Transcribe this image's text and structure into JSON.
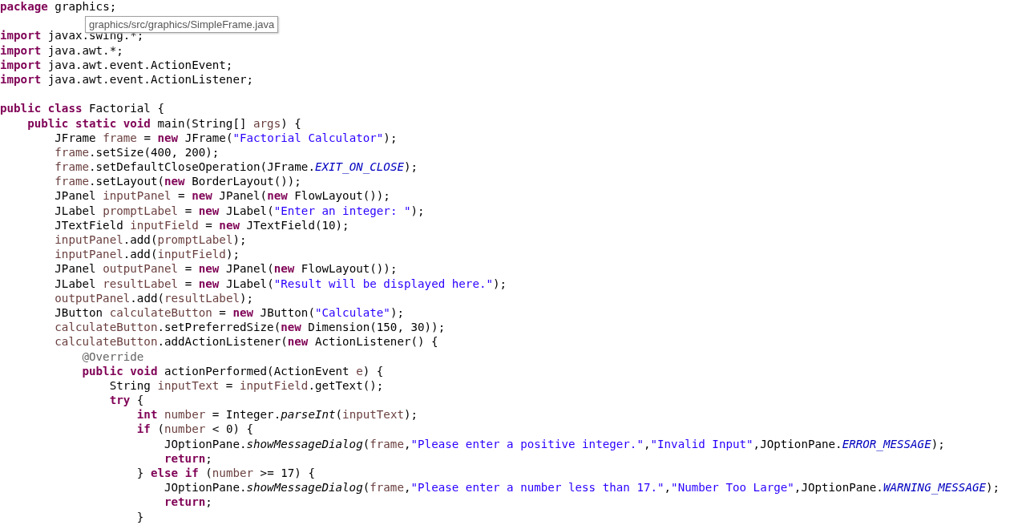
{
  "editor": {
    "lines": [
      {
        "kind": "code",
        "tokens": [
          {
            "kind": "keyword",
            "text": "package"
          },
          {
            "kind": "plain",
            "text": " graphics;"
          }
        ]
      },
      {
        "kind": "blank"
      },
      {
        "kind": "code",
        "tokens": [
          {
            "kind": "keyword",
            "text": "import"
          },
          {
            "kind": "plain",
            "text": " javax.swing.*;"
          }
        ]
      },
      {
        "kind": "code",
        "tokens": [
          {
            "kind": "keyword",
            "text": "import"
          },
          {
            "kind": "plain",
            "text": " java.awt.*;"
          }
        ]
      },
      {
        "kind": "code",
        "tokens": [
          {
            "kind": "keyword",
            "text": "import"
          },
          {
            "kind": "plain",
            "text": " java.awt.event.ActionEvent;"
          }
        ]
      },
      {
        "kind": "code",
        "tokens": [
          {
            "kind": "keyword",
            "text": "import"
          },
          {
            "kind": "plain",
            "text": " java.awt.event.ActionListener;"
          }
        ]
      },
      {
        "kind": "blank"
      },
      {
        "kind": "code",
        "tokens": [
          {
            "kind": "keyword",
            "text": "public class"
          },
          {
            "kind": "plain",
            "text": " Factorial {"
          }
        ],
        "children": [
          {
            "kind": "code",
            "tokens": [
              {
                "kind": "keyword",
                "text": "public static void"
              },
              {
                "kind": "plain",
                "text": " main(String[] "
              },
              {
                "kind": "variable",
                "text": "args"
              },
              {
                "kind": "plain",
                "text": ") {"
              }
            ],
            "children": [
              {
                "kind": "code",
                "tokens": [
                  {
                    "kind": "plain",
                    "text": "JFrame "
                  },
                  {
                    "kind": "variable",
                    "text": "frame"
                  },
                  {
                    "kind": "plain",
                    "text": " = "
                  },
                  {
                    "kind": "keyword",
                    "text": "new"
                  },
                  {
                    "kind": "plain",
                    "text": " JFrame("
                  },
                  {
                    "kind": "string",
                    "text": "\"Factorial Calculator\""
                  },
                  {
                    "kind": "plain",
                    "text": ");"
                  }
                ]
              },
              {
                "kind": "code",
                "tokens": [
                  {
                    "kind": "variable",
                    "text": "frame"
                  },
                  {
                    "kind": "plain",
                    "text": ".setSize(400, 200);"
                  }
                ]
              },
              {
                "kind": "code",
                "tokens": [
                  {
                    "kind": "variable",
                    "text": "frame"
                  },
                  {
                    "kind": "plain",
                    "text": ".setDefaultCloseOperation(JFrame."
                  },
                  {
                    "kind": "constant",
                    "text": "EXIT_ON_CLOSE"
                  },
                  {
                    "kind": "plain",
                    "text": ");"
                  }
                ]
              },
              {
                "kind": "code",
                "tokens": [
                  {
                    "kind": "variable",
                    "text": "frame"
                  },
                  {
                    "kind": "plain",
                    "text": ".setLayout("
                  },
                  {
                    "kind": "keyword",
                    "text": "new"
                  },
                  {
                    "kind": "plain",
                    "text": " BorderLayout());"
                  }
                ]
              },
              {
                "kind": "code",
                "tokens": [
                  {
                    "kind": "plain",
                    "text": "JPanel "
                  },
                  {
                    "kind": "variable",
                    "text": "inputPanel"
                  },
                  {
                    "kind": "plain",
                    "text": " = "
                  },
                  {
                    "kind": "keyword",
                    "text": "new"
                  },
                  {
                    "kind": "plain",
                    "text": " JPanel("
                  },
                  {
                    "kind": "keyword",
                    "text": "new"
                  },
                  {
                    "kind": "plain",
                    "text": " FlowLayout());"
                  }
                ]
              },
              {
                "kind": "code",
                "tokens": [
                  {
                    "kind": "plain",
                    "text": "JLabel "
                  },
                  {
                    "kind": "variable",
                    "text": "promptLabel"
                  },
                  {
                    "kind": "plain",
                    "text": " = "
                  },
                  {
                    "kind": "keyword",
                    "text": "new"
                  },
                  {
                    "kind": "plain",
                    "text": " JLabel("
                  },
                  {
                    "kind": "string",
                    "text": "\"Enter an integer: \""
                  },
                  {
                    "kind": "plain",
                    "text": ");"
                  }
                ]
              },
              {
                "kind": "code",
                "tokens": [
                  {
                    "kind": "plain",
                    "text": "JTextField "
                  },
                  {
                    "kind": "variable",
                    "text": "inputField"
                  },
                  {
                    "kind": "plain",
                    "text": " = "
                  },
                  {
                    "kind": "keyword",
                    "text": "new"
                  },
                  {
                    "kind": "plain",
                    "text": " JTextField(10);"
                  }
                ]
              },
              {
                "kind": "code",
                "tokens": [
                  {
                    "kind": "variable",
                    "text": "inputPanel"
                  },
                  {
                    "kind": "plain",
                    "text": ".add("
                  },
                  {
                    "kind": "variable",
                    "text": "promptLabel"
                  },
                  {
                    "kind": "plain",
                    "text": ");"
                  }
                ]
              },
              {
                "kind": "code",
                "tokens": [
                  {
                    "kind": "variable",
                    "text": "inputPanel"
                  },
                  {
                    "kind": "plain",
                    "text": ".add("
                  },
                  {
                    "kind": "variable",
                    "text": "inputField"
                  },
                  {
                    "kind": "plain",
                    "text": ");"
                  }
                ]
              },
              {
                "kind": "code",
                "tokens": [
                  {
                    "kind": "plain",
                    "text": "JPanel "
                  },
                  {
                    "kind": "variable",
                    "text": "outputPanel"
                  },
                  {
                    "kind": "plain",
                    "text": " = "
                  },
                  {
                    "kind": "keyword",
                    "text": "new"
                  },
                  {
                    "kind": "plain",
                    "text": " JPanel("
                  },
                  {
                    "kind": "keyword",
                    "text": "new"
                  },
                  {
                    "kind": "plain",
                    "text": " FlowLayout());"
                  }
                ]
              },
              {
                "kind": "code",
                "tokens": [
                  {
                    "kind": "plain",
                    "text": "JLabel "
                  },
                  {
                    "kind": "variable",
                    "text": "resultLabel"
                  },
                  {
                    "kind": "plain",
                    "text": " = "
                  },
                  {
                    "kind": "keyword",
                    "text": "new"
                  },
                  {
                    "kind": "plain",
                    "text": " JLabel("
                  },
                  {
                    "kind": "string",
                    "text": "\"Result will be displayed here.\""
                  },
                  {
                    "kind": "plain",
                    "text": ");"
                  }
                ]
              },
              {
                "kind": "code",
                "tokens": [
                  {
                    "kind": "variable",
                    "text": "outputPanel"
                  },
                  {
                    "kind": "plain",
                    "text": ".add("
                  },
                  {
                    "kind": "variable",
                    "text": "resultLabel"
                  },
                  {
                    "kind": "plain",
                    "text": ");"
                  }
                ]
              },
              {
                "kind": "code",
                "tokens": [
                  {
                    "kind": "plain",
                    "text": "JButton "
                  },
                  {
                    "kind": "variable",
                    "text": "calculateButton"
                  },
                  {
                    "kind": "plain",
                    "text": " = "
                  },
                  {
                    "kind": "keyword",
                    "text": "new"
                  },
                  {
                    "kind": "plain",
                    "text": " JButton("
                  },
                  {
                    "kind": "string",
                    "text": "\"Calculate\""
                  },
                  {
                    "kind": "plain",
                    "text": ");"
                  }
                ]
              },
              {
                "kind": "code",
                "tokens": [
                  {
                    "kind": "variable",
                    "text": "calculateButton"
                  },
                  {
                    "kind": "plain",
                    "text": ".setPreferredSize("
                  },
                  {
                    "kind": "keyword",
                    "text": "new"
                  },
                  {
                    "kind": "plain",
                    "text": " Dimension(150, 30));"
                  }
                ]
              },
              {
                "kind": "code",
                "tokens": [
                  {
                    "kind": "variable",
                    "text": "calculateButton"
                  },
                  {
                    "kind": "plain",
                    "text": ".addActionListener("
                  },
                  {
                    "kind": "keyword",
                    "text": "new"
                  },
                  {
                    "kind": "plain",
                    "text": " ActionListener() {"
                  }
                ],
                "children": [
                  {
                    "kind": "code",
                    "tokens": [
                      {
                        "kind": "annotation",
                        "text": "@Override"
                      }
                    ]
                  },
                  {
                    "kind": "code",
                    "tokens": [
                      {
                        "kind": "keyword",
                        "text": "public void"
                      },
                      {
                        "kind": "plain",
                        "text": " actionPerformed(ActionEvent "
                      },
                      {
                        "kind": "variable",
                        "text": "e"
                      },
                      {
                        "kind": "plain",
                        "text": ") {"
                      }
                    ],
                    "children": [
                      {
                        "kind": "code",
                        "tokens": [
                          {
                            "kind": "plain",
                            "text": "String "
                          },
                          {
                            "kind": "variable",
                            "text": "inputText"
                          },
                          {
                            "kind": "plain",
                            "text": " = "
                          },
                          {
                            "kind": "variable",
                            "text": "inputField"
                          },
                          {
                            "kind": "plain",
                            "text": ".getText();"
                          }
                        ]
                      },
                      {
                        "kind": "code",
                        "tokens": [
                          {
                            "kind": "keyword",
                            "text": "try"
                          },
                          {
                            "kind": "plain",
                            "text": " {"
                          }
                        ],
                        "children": [
                          {
                            "kind": "code",
                            "tokens": [
                              {
                                "kind": "keyword",
                                "text": "int "
                              },
                              {
                                "kind": "variable",
                                "text": "number"
                              },
                              {
                                "kind": "plain",
                                "text": " = Integer."
                              },
                              {
                                "kind": "static",
                                "text": "parseInt"
                              },
                              {
                                "kind": "plain",
                                "text": "("
                              },
                              {
                                "kind": "variable",
                                "text": "inputText"
                              },
                              {
                                "kind": "plain",
                                "text": ");"
                              }
                            ]
                          },
                          {
                            "kind": "code",
                            "tokens": [
                              {
                                "kind": "keyword",
                                "text": "if"
                              },
                              {
                                "kind": "plain",
                                "text": " ("
                              },
                              {
                                "kind": "variable",
                                "text": "number"
                              },
                              {
                                "kind": "plain",
                                "text": " < 0) {"
                              }
                            ],
                            "children": [
                              {
                                "kind": "code",
                                "tokens": [
                                  {
                                    "kind": "plain",
                                    "text": "JOptionPane."
                                  },
                                  {
                                    "kind": "static",
                                    "text": "showMessageDialog"
                                  },
                                  {
                                    "kind": "plain",
                                    "text": "("
                                  },
                                  {
                                    "kind": "variable",
                                    "text": "frame"
                                  },
                                  {
                                    "kind": "plain",
                                    "text": ","
                                  },
                                  {
                                    "kind": "string",
                                    "text": "\"Please enter a positive integer.\""
                                  },
                                  {
                                    "kind": "plain",
                                    "text": ","
                                  },
                                  {
                                    "kind": "string",
                                    "text": "\"Invalid Input\""
                                  },
                                  {
                                    "kind": "plain",
                                    "text": ",JOptionPane."
                                  },
                                  {
                                    "kind": "constant",
                                    "text": "ERROR_MESSAGE"
                                  },
                                  {
                                    "kind": "plain",
                                    "text": ");"
                                  }
                                ]
                              },
                              {
                                "kind": "code",
                                "tokens": [
                                  {
                                    "kind": "keyword",
                                    "text": "return"
                                  },
                                  {
                                    "kind": "plain",
                                    "text": ";"
                                  }
                                ]
                              }
                            ]
                          },
                          {
                            "kind": "code",
                            "tokens": [
                              {
                                "kind": "plain",
                                "text": "} "
                              },
                              {
                                "kind": "keyword",
                                "text": "else if"
                              },
                              {
                                "kind": "plain",
                                "text": " ("
                              },
                              {
                                "kind": "variable",
                                "text": "number"
                              },
                              {
                                "kind": "plain",
                                "text": " >= 17) {"
                              }
                            ],
                            "children": [
                              {
                                "kind": "code",
                                "tokens": [
                                  {
                                    "kind": "plain",
                                    "text": "JOptionPane."
                                  },
                                  {
                                    "kind": "static",
                                    "text": "showMessageDialog"
                                  },
                                  {
                                    "kind": "plain",
                                    "text": "("
                                  },
                                  {
                                    "kind": "variable",
                                    "text": "frame"
                                  },
                                  {
                                    "kind": "plain",
                                    "text": ","
                                  },
                                  {
                                    "kind": "string",
                                    "text": "\"Please enter a number less than 17.\""
                                  },
                                  {
                                    "kind": "plain",
                                    "text": ","
                                  },
                                  {
                                    "kind": "string",
                                    "text": "\"Number Too Large\""
                                  },
                                  {
                                    "kind": "plain",
                                    "text": ",JOptionPane."
                                  },
                                  {
                                    "kind": "constant",
                                    "text": "WARNING_MESSAGE"
                                  },
                                  {
                                    "kind": "plain",
                                    "text": ");"
                                  }
                                ]
                              },
                              {
                                "kind": "code",
                                "tokens": [
                                  {
                                    "kind": "keyword",
                                    "text": "return"
                                  },
                                  {
                                    "kind": "plain",
                                    "text": ";"
                                  }
                                ]
                              }
                            ]
                          },
                          {
                            "kind": "code",
                            "tokens": [
                              {
                                "kind": "plain",
                                "text": "}"
                              }
                            ]
                          }
                        ]
                      }
                    ]
                  }
                ]
              }
            ]
          }
        ]
      }
    ]
  },
  "tooltip": {
    "text": "graphics/src/graphics/SimpleFrame.java"
  }
}
